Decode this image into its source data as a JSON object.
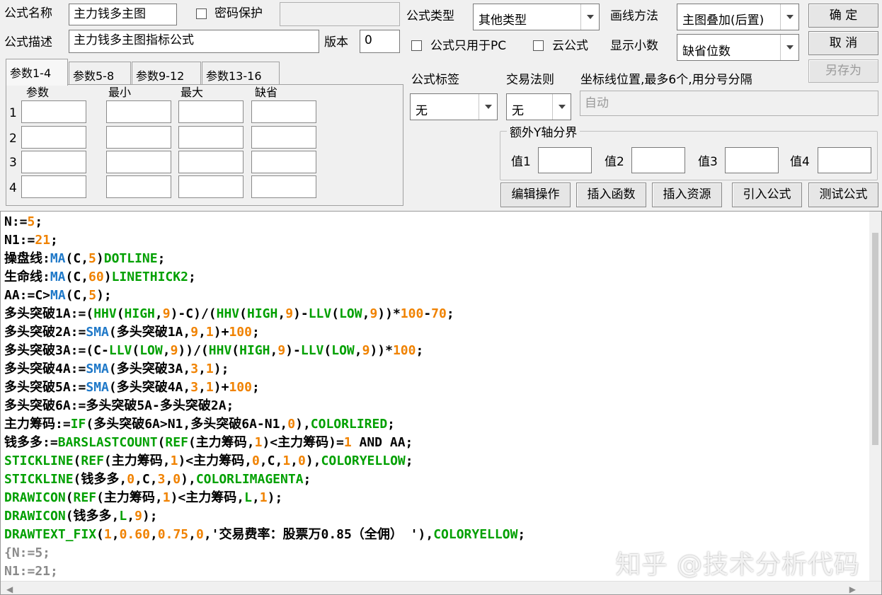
{
  "top": {
    "name_label": "公式名称",
    "name_value": "主力钱多主图",
    "password_label": "密码保护",
    "password_value": "",
    "desc_label": "公式描述",
    "desc_value": "主力钱多主图指标公式",
    "version_label": "版本",
    "version_value": "0"
  },
  "options": {
    "type_label": "公式类型",
    "type_value": "其他类型",
    "draw_label": "画线方法",
    "draw_value": "主图叠加(后置)",
    "pc_only_label": "公式只用于PC",
    "cloud_label": "云公式",
    "decimals_label": "显示小数",
    "decimals_value": "缺省位数",
    "tag_label": "公式标签",
    "tag_value": "无",
    "trade_label": "交易法则",
    "trade_value": "无",
    "coord_label": "坐标线位置,最多6个,用分号分隔",
    "coord_value": "自动",
    "extra_y_label": "额外Y轴分界",
    "v1_label": "值1",
    "v2_label": "值2",
    "v3_label": "值3",
    "v4_label": "值4"
  },
  "buttons": {
    "ok": "确  定",
    "cancel": "取  消",
    "save_as": "另存为",
    "edit_ops": "编辑操作",
    "insert_func": "插入函数",
    "insert_res": "插入资源",
    "import": "引入公式",
    "test": "测试公式"
  },
  "params": {
    "tabs": [
      "参数1-4",
      "参数5-8",
      "参数9-12",
      "参数13-16"
    ],
    "headers": [
      "参数",
      "最小",
      "最大",
      "缺省"
    ],
    "rows": [
      "1",
      "2",
      "3",
      "4"
    ]
  },
  "code_lines": [
    [
      [
        "k",
        "N:="
      ],
      [
        "n",
        "5"
      ],
      [
        "k",
        ";"
      ]
    ],
    [
      [
        "k",
        "N1:="
      ],
      [
        "n",
        "21"
      ],
      [
        "k",
        ";"
      ]
    ],
    [
      [
        "k",
        "操盘线:"
      ],
      [
        "f",
        "MA"
      ],
      [
        "k",
        "(C,"
      ],
      [
        "n",
        "5"
      ],
      [
        "k",
        ")"
      ],
      [
        "g",
        "DOTLINE"
      ],
      [
        "k",
        ";"
      ]
    ],
    [
      [
        "k",
        "生命线:"
      ],
      [
        "f",
        "MA"
      ],
      [
        "k",
        "(C,"
      ],
      [
        "n",
        "60"
      ],
      [
        "k",
        ")"
      ],
      [
        "g",
        "LINETHICK2"
      ],
      [
        "k",
        ";"
      ]
    ],
    [
      [
        "k",
        "AA:=C>"
      ],
      [
        "f",
        "MA"
      ],
      [
        "k",
        "(C,"
      ],
      [
        "n",
        "5"
      ],
      [
        "k",
        ");"
      ]
    ],
    [
      [
        "k",
        "多头突破1A:=("
      ],
      [
        "g",
        "HHV"
      ],
      [
        "k",
        "("
      ],
      [
        "g",
        "HIGH"
      ],
      [
        "k",
        ","
      ],
      [
        "n",
        "9"
      ],
      [
        "k",
        ")-C)/("
      ],
      [
        "g",
        "HHV"
      ],
      [
        "k",
        "("
      ],
      [
        "g",
        "HIGH"
      ],
      [
        "k",
        ","
      ],
      [
        "n",
        "9"
      ],
      [
        "k",
        ")-"
      ],
      [
        "g",
        "LLV"
      ],
      [
        "k",
        "("
      ],
      [
        "g",
        "LOW"
      ],
      [
        "k",
        ","
      ],
      [
        "n",
        "9"
      ],
      [
        "k",
        "))*"
      ],
      [
        "n",
        "100"
      ],
      [
        "k",
        "-"
      ],
      [
        "n",
        "70"
      ],
      [
        "k",
        ";"
      ]
    ],
    [
      [
        "k",
        "多头突破2A:="
      ],
      [
        "f",
        "SMA"
      ],
      [
        "k",
        "(多头突破1A,"
      ],
      [
        "n",
        "9"
      ],
      [
        "k",
        ","
      ],
      [
        "n",
        "1"
      ],
      [
        "k",
        ")+"
      ],
      [
        "n",
        "100"
      ],
      [
        "k",
        ";"
      ]
    ],
    [
      [
        "k",
        "多头突破3A:=(C-"
      ],
      [
        "g",
        "LLV"
      ],
      [
        "k",
        "("
      ],
      [
        "g",
        "LOW"
      ],
      [
        "k",
        ","
      ],
      [
        "n",
        "9"
      ],
      [
        "k",
        "))/("
      ],
      [
        "g",
        "HHV"
      ],
      [
        "k",
        "("
      ],
      [
        "g",
        "HIGH"
      ],
      [
        "k",
        ","
      ],
      [
        "n",
        "9"
      ],
      [
        "k",
        ")-"
      ],
      [
        "g",
        "LLV"
      ],
      [
        "k",
        "("
      ],
      [
        "g",
        "LOW"
      ],
      [
        "k",
        ","
      ],
      [
        "n",
        "9"
      ],
      [
        "k",
        "))*"
      ],
      [
        "n",
        "100"
      ],
      [
        "k",
        ";"
      ]
    ],
    [
      [
        "k",
        "多头突破4A:="
      ],
      [
        "f",
        "SMA"
      ],
      [
        "k",
        "(多头突破3A,"
      ],
      [
        "n",
        "3"
      ],
      [
        "k",
        ","
      ],
      [
        "n",
        "1"
      ],
      [
        "k",
        ");"
      ]
    ],
    [
      [
        "k",
        "多头突破5A:="
      ],
      [
        "f",
        "SMA"
      ],
      [
        "k",
        "(多头突破4A,"
      ],
      [
        "n",
        "3"
      ],
      [
        "k",
        ","
      ],
      [
        "n",
        "1"
      ],
      [
        "k",
        ")+"
      ],
      [
        "n",
        "100"
      ],
      [
        "k",
        ";"
      ]
    ],
    [
      [
        "k",
        "多头突破6A:=多头突破5A-多头突破2A;"
      ]
    ],
    [
      [
        "k",
        "主力筹码:="
      ],
      [
        "g",
        "IF"
      ],
      [
        "k",
        "(多头突破6A>N1,多头突破6A-N1,"
      ],
      [
        "n",
        "0"
      ],
      [
        "k",
        "),"
      ],
      [
        "g",
        "COLORLIRED"
      ],
      [
        "k",
        ";"
      ]
    ],
    [
      [
        "k",
        "钱多多:="
      ],
      [
        "g",
        "BARSLASTCOUNT"
      ],
      [
        "k",
        "("
      ],
      [
        "g",
        "REF"
      ],
      [
        "k",
        "(主力筹码,"
      ],
      [
        "n",
        "1"
      ],
      [
        "k",
        ")<主力筹码)="
      ],
      [
        "n",
        "1"
      ],
      [
        "k",
        " AND AA;"
      ]
    ],
    [
      [
        "g",
        "STICKLINE"
      ],
      [
        "k",
        "("
      ],
      [
        "g",
        "REF"
      ],
      [
        "k",
        "(主力筹码,"
      ],
      [
        "n",
        "1"
      ],
      [
        "k",
        ")<主力筹码,"
      ],
      [
        "n",
        "0"
      ],
      [
        "k",
        ",C,"
      ],
      [
        "n",
        "1"
      ],
      [
        "k",
        ","
      ],
      [
        "n",
        "0"
      ],
      [
        "k",
        "),"
      ],
      [
        "g",
        "COLORYELLOW"
      ],
      [
        "k",
        ";"
      ]
    ],
    [
      [
        "g",
        "STICKLINE"
      ],
      [
        "k",
        "(钱多多,"
      ],
      [
        "n",
        "0"
      ],
      [
        "k",
        ",C,"
      ],
      [
        "n",
        "3"
      ],
      [
        "k",
        ","
      ],
      [
        "n",
        "0"
      ],
      [
        "k",
        "),"
      ],
      [
        "g",
        "COLORLIMAGENTA"
      ],
      [
        "k",
        ";"
      ]
    ],
    [
      [
        "g",
        "DRAWICON"
      ],
      [
        "k",
        "("
      ],
      [
        "g",
        "REF"
      ],
      [
        "k",
        "(主力筹码,"
      ],
      [
        "n",
        "1"
      ],
      [
        "k",
        ")<主力筹码,"
      ],
      [
        "g",
        "L"
      ],
      [
        "k",
        ","
      ],
      [
        "n",
        "1"
      ],
      [
        "k",
        ");"
      ]
    ],
    [
      [
        "g",
        "DRAWICON"
      ],
      [
        "k",
        "(钱多多,"
      ],
      [
        "g",
        "L"
      ],
      [
        "k",
        ","
      ],
      [
        "n",
        "9"
      ],
      [
        "k",
        ");"
      ]
    ],
    [
      [
        "g",
        "DRAWTEXT_FIX"
      ],
      [
        "k",
        "("
      ],
      [
        "n",
        "1"
      ],
      [
        "k",
        ","
      ],
      [
        "n",
        "0.60"
      ],
      [
        "k",
        ","
      ],
      [
        "n",
        "0.75"
      ],
      [
        "k",
        ","
      ],
      [
        "n",
        "0"
      ],
      [
        "k",
        ",'交易费率：股票万0.85（全佣） '),"
      ],
      [
        "g",
        "COLORYELLOW"
      ],
      [
        "k",
        ";"
      ]
    ],
    [
      [
        "c",
        "{N:=5;"
      ]
    ],
    [
      [
        "c",
        "N1:=21;"
      ]
    ]
  ],
  "watermark": "知乎 @技术分析代码",
  "colors": {
    "number": "#f08200",
    "function_blue": "#1e78c8",
    "keyword_green": "#00a000",
    "comment": "#8a8a8a"
  }
}
